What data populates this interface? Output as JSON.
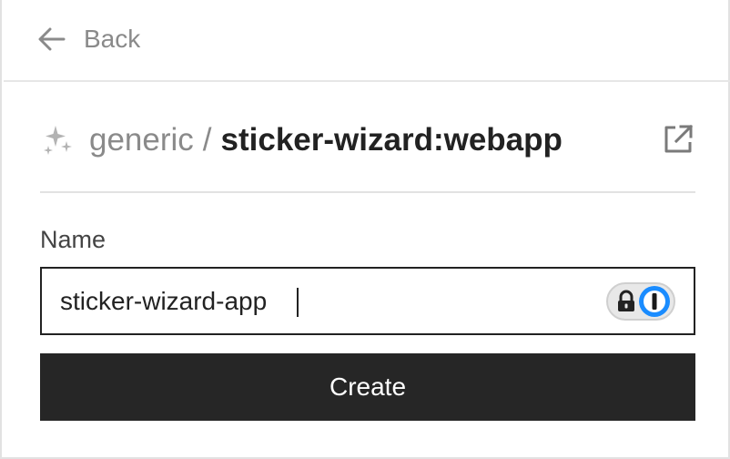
{
  "header": {
    "back_label": "Back"
  },
  "title": {
    "namespace": "generic",
    "separator": "/",
    "name": "sticker-wizard:webapp"
  },
  "form": {
    "name_label": "Name",
    "name_value": "sticker-wizard-app",
    "submit_label": "Create"
  },
  "icons": {
    "back": "arrow-left-icon",
    "title": "sparkle-icon",
    "open": "external-link-icon",
    "lock": "lock-icon",
    "password_manager": "onepassword-icon"
  },
  "colors": {
    "muted_text": "#8a8a8a",
    "primary_button": "#262626",
    "password_manager_blue": "#1a8cff"
  }
}
